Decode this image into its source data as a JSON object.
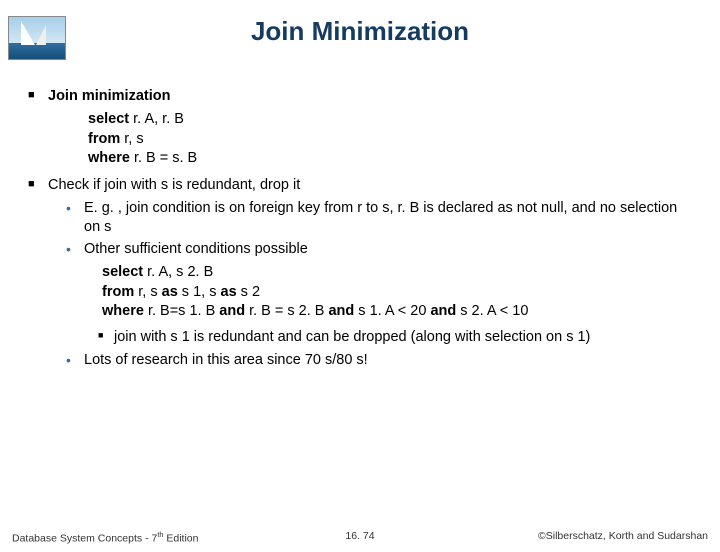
{
  "title": "Join Minimization",
  "b1": {
    "heading": "Join minimization"
  },
  "code1": {
    "l1a": "select",
    "l1b": " r. A, r. B",
    "l2a": "from",
    "l2b": " r, s",
    "l3a": "where",
    "l3b": " r. B = s. B"
  },
  "b2": {
    "heading": "Check if join with s is redundant, drop it"
  },
  "s1": "E. g. , join condition is on foreign key from r to s, r. B is declared as not null, and no selection on s",
  "s2": "Other sufficient conditions possible",
  "code2": {
    "l1a": "select",
    "l1b": " r. A, s 2. B",
    "l2a": "from",
    "l2b": " r, s ",
    "l2c": "as",
    "l2d": " s 1, s ",
    "l2e": "as",
    "l2f": " s 2",
    "l3a": "where",
    "l3b": " r. B=s 1. B ",
    "l3c": "and",
    "l3d": " r. B = s 2. B ",
    "l3e": "and",
    "l3f": " s 1. A < 20 ",
    "l3g": "and",
    "l3h": " s 2. A < 10"
  },
  "s2s1": "join with s 1 is redundant and can be dropped (along with selection on s 1)",
  "s3": "Lots of research in this area since 70 s/80 s!",
  "footer": {
    "left_a": "Database System Concepts - 7",
    "left_b": "th",
    "left_c": " Edition",
    "center": "16. 74",
    "right": "©Silberschatz, Korth and Sudarshan"
  }
}
